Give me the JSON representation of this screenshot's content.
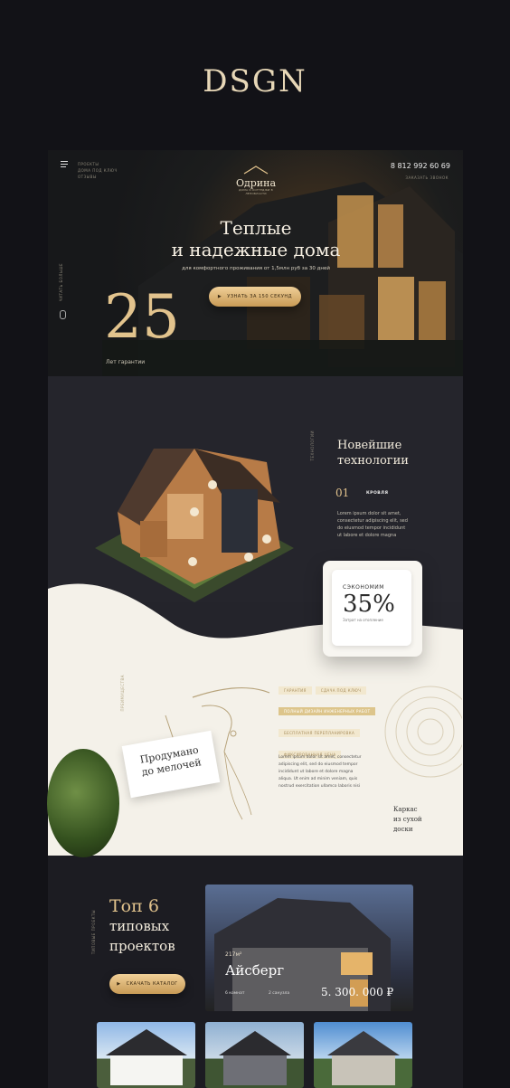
{
  "brand": {
    "logo_text": "DSGN"
  },
  "header": {
    "menu_lines": [
      "ПРОЕКТЫ",
      "ДОМА ПОД КЛЮЧ",
      "ОТЗЫВЫ"
    ],
    "logo_name": "Одрина",
    "logo_sub": "ДОМА И КОТТЕДЖИ В ЛЕНОБЛАСТИ",
    "phone": "8 812 992 60 69",
    "callback_label": "ЗАКАЗАТЬ ЗВОНОК"
  },
  "hero": {
    "title_line1": "Теплые",
    "title_line2": "и надежные дома",
    "subtitle": "для комфортного проживания от 1,5млн руб за 30 дней",
    "cta_label": "УЗНАТЬ ЗА 150 СЕКУНД",
    "side_label": "ЧИТАТЬ БОЛЬШЕ",
    "stat_number": "25",
    "stat_label": "Лет гарантии"
  },
  "tech": {
    "side_label": "ТЕХНОЛОГИИ",
    "title_line1": "Новейшие",
    "title_line2": "технологии",
    "index": "01",
    "item_label": "КРОВЛЯ",
    "body": [
      "Lorem ipsum dolor sit amet,",
      "consectetur adipiscing elit, sed",
      "do eiusmod tempor incididunt",
      "ut labore et dolore magna"
    ]
  },
  "savings": {
    "label": "СЭКОНОМИМ",
    "value": "35%",
    "caption": "Затрат на отопление"
  },
  "details": {
    "side_label": "ПРЕИМУЩЕСТВА",
    "card_line1": "Продумано",
    "card_line2": "до мелочей",
    "tags": [
      {
        "label": "ГАРАНТИЯ",
        "active": false
      },
      {
        "label": "СДАЧА ПОД КЛЮЧ",
        "active": false
      },
      {
        "label": "ПОЛНЫЙ ДИЗАЙН ИНЖЕНЕРНЫХ РАБОТ",
        "active": true
      },
      {
        "label": "БЕСПЛАТНАЯ ПЕРЕПЛАНИРОВКА",
        "active": false
      },
      {
        "label": "ФИКСИРОВАННАЯ ЦЕНА",
        "active": false
      }
    ],
    "body": [
      "Lorem ipsum dolor sit amet, consectetur",
      "adipiscing elit, sed do eiusmod tempor",
      "incididunt ut labore et dolore magna",
      "aliqua. Ut enim ad minim veniam, quis",
      "nostrud exercitation ullamco laboris nisi"
    ],
    "frame_line1": "Каркас",
    "frame_line2": "из сухой",
    "frame_line3": "доски"
  },
  "projects": {
    "side_label": "ТИПОВЫЕ ПРОЕКТЫ",
    "title_line1": "Топ 6",
    "title_line2": "типовых",
    "title_line3": "проектов",
    "cta_label": "СКАЧАТЬ КАТАЛОГ",
    "featured": {
      "area": "217м²",
      "name": "Айсберг",
      "rooms": "6 комнат",
      "baths": "2 санузла",
      "price": "5. 300. 000 ₽"
    }
  },
  "colors": {
    "accent_gold": "#e2c38d",
    "dark_bg": "#121217",
    "cream": "#f4f1e9"
  }
}
